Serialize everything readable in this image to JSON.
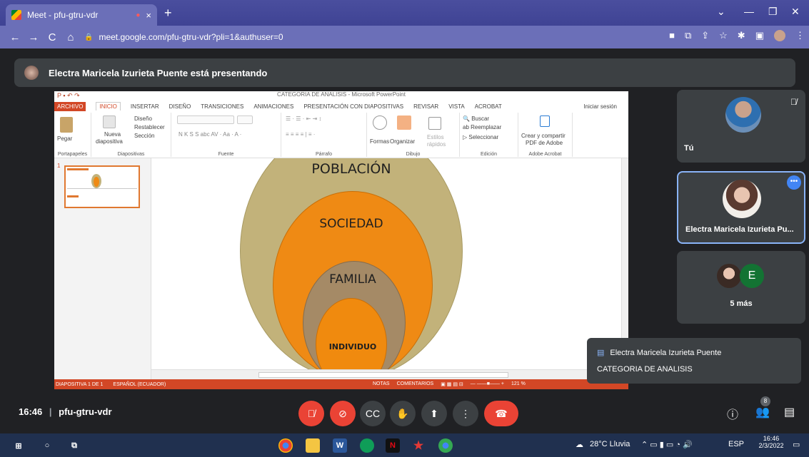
{
  "browser": {
    "tab_title": "Meet - pfu-gtru-vdr",
    "tab_close": "×",
    "new_tab": "+",
    "url": "meet.google.com/pfu-gtru-vdr?pli=1&authuser=0"
  },
  "meet": {
    "presenting_banner": "Electra Maricela Izurieta Puente está presentando",
    "meeting_time": "16:46",
    "meeting_code": "pfu-gtru-vdr",
    "participants_badge": "8"
  },
  "powerpoint": {
    "window_title": "CATEGORIA DE ANALISIS - Microsoft PowerPoint",
    "tabs": [
      "ARCHIVO",
      "INICIO",
      "INSERTAR",
      "DISEÑO",
      "TRANSICIONES",
      "ANIMACIONES",
      "PRESENTACIÓN CON DIAPOSITIVAS",
      "REVISAR",
      "VISTA",
      "ACROBAT"
    ],
    "sign_in": "Iniciar sesión",
    "ribbon": {
      "pegar": "Pegar",
      "portapapeles": "Portapapeles",
      "nueva": "Nueva",
      "diapositiva": "diapositiva",
      "diseno": "Diseño",
      "restablecer": "Restablecer",
      "seccion": "Sección",
      "diapositivas": "Diapositivas",
      "fuente_fmt": "N  K  S  S  abc  AV · Aa ·  A ·",
      "fuente": "Fuente",
      "parrafo": "Párrafo",
      "formas": "Formas",
      "organizar": "Organizar",
      "estilos": "Estilos",
      "rapidos": "rápidos",
      "dibujo": "Dibujo",
      "buscar": "Buscar",
      "reemplazar": "Reemplazar",
      "seleccionar": "Seleccionar",
      "edicion": "Edición",
      "crear_compartir": "Crear y compartir",
      "pdf_adobe": "PDF de Adobe",
      "adobe_acrobat": "Adobe Acrobat"
    },
    "slide_number": "1",
    "slide_labels": {
      "poblacion": "POBLACIÓN",
      "sociedad": "SOCIEDAD",
      "familia": "FAMILIA",
      "individuo": "INDIVIDUO"
    },
    "status": {
      "slide_info": "DIAPOSITIVA 1 DE 1",
      "language": "ESPAÑOL (ECUADOR)",
      "notas": "NOTAS",
      "comentarios": "COMENTARIOS",
      "zoom": "121 %"
    },
    "colors": {
      "outer": "#c2b27a",
      "middle": "#ef8a14",
      "inner": "#a58a66",
      "core": "#f08a0e",
      "accent": "#d24726"
    }
  },
  "participants": {
    "self_label": "Tú",
    "presenter_name": "Electra Maricela Izurieta Pu...",
    "more_initial": "E",
    "more_label": "5 más"
  },
  "toast": {
    "from": "Electra Maricela Izurieta Puente",
    "message": "CATEGORIA DE ANALISIS"
  },
  "taskbar": {
    "weather": "28°C  Lluvia",
    "lang": "ESP",
    "time": "16:46",
    "date": "2/3/2022"
  }
}
